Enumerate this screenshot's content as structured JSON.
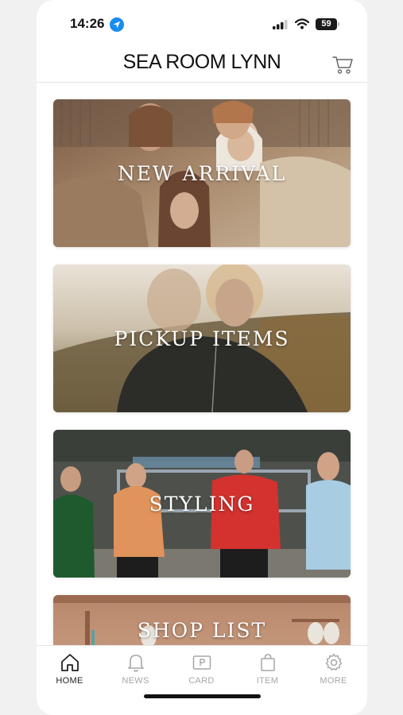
{
  "status_bar": {
    "time": "14:26",
    "battery_level": "59",
    "icons": [
      "location-arrow-icon",
      "cellular-signal-icon",
      "wifi-icon",
      "battery-icon"
    ]
  },
  "header": {
    "brand": "SEA ROOM LYNN",
    "cart_icon": "cart-icon"
  },
  "banners": [
    {
      "label": "NEW ARRIVAL"
    },
    {
      "label": "PICKUP ITEMS"
    },
    {
      "label": "STYLING"
    },
    {
      "label": "SHOP LIST"
    }
  ],
  "tabs": [
    {
      "label": "HOME",
      "icon": "home-icon",
      "active": true
    },
    {
      "label": "NEWS",
      "icon": "bell-icon",
      "active": false
    },
    {
      "label": "CARD",
      "icon": "card-icon",
      "active": false
    },
    {
      "label": "ITEM",
      "icon": "shopping-bag-icon",
      "active": false
    },
    {
      "label": "MORE",
      "icon": "gear-icon",
      "active": false
    }
  ],
  "colors": {
    "tab_active": "#222222",
    "tab_inactive": "#a6a6a6",
    "location_accent": "#1a8cf0"
  }
}
